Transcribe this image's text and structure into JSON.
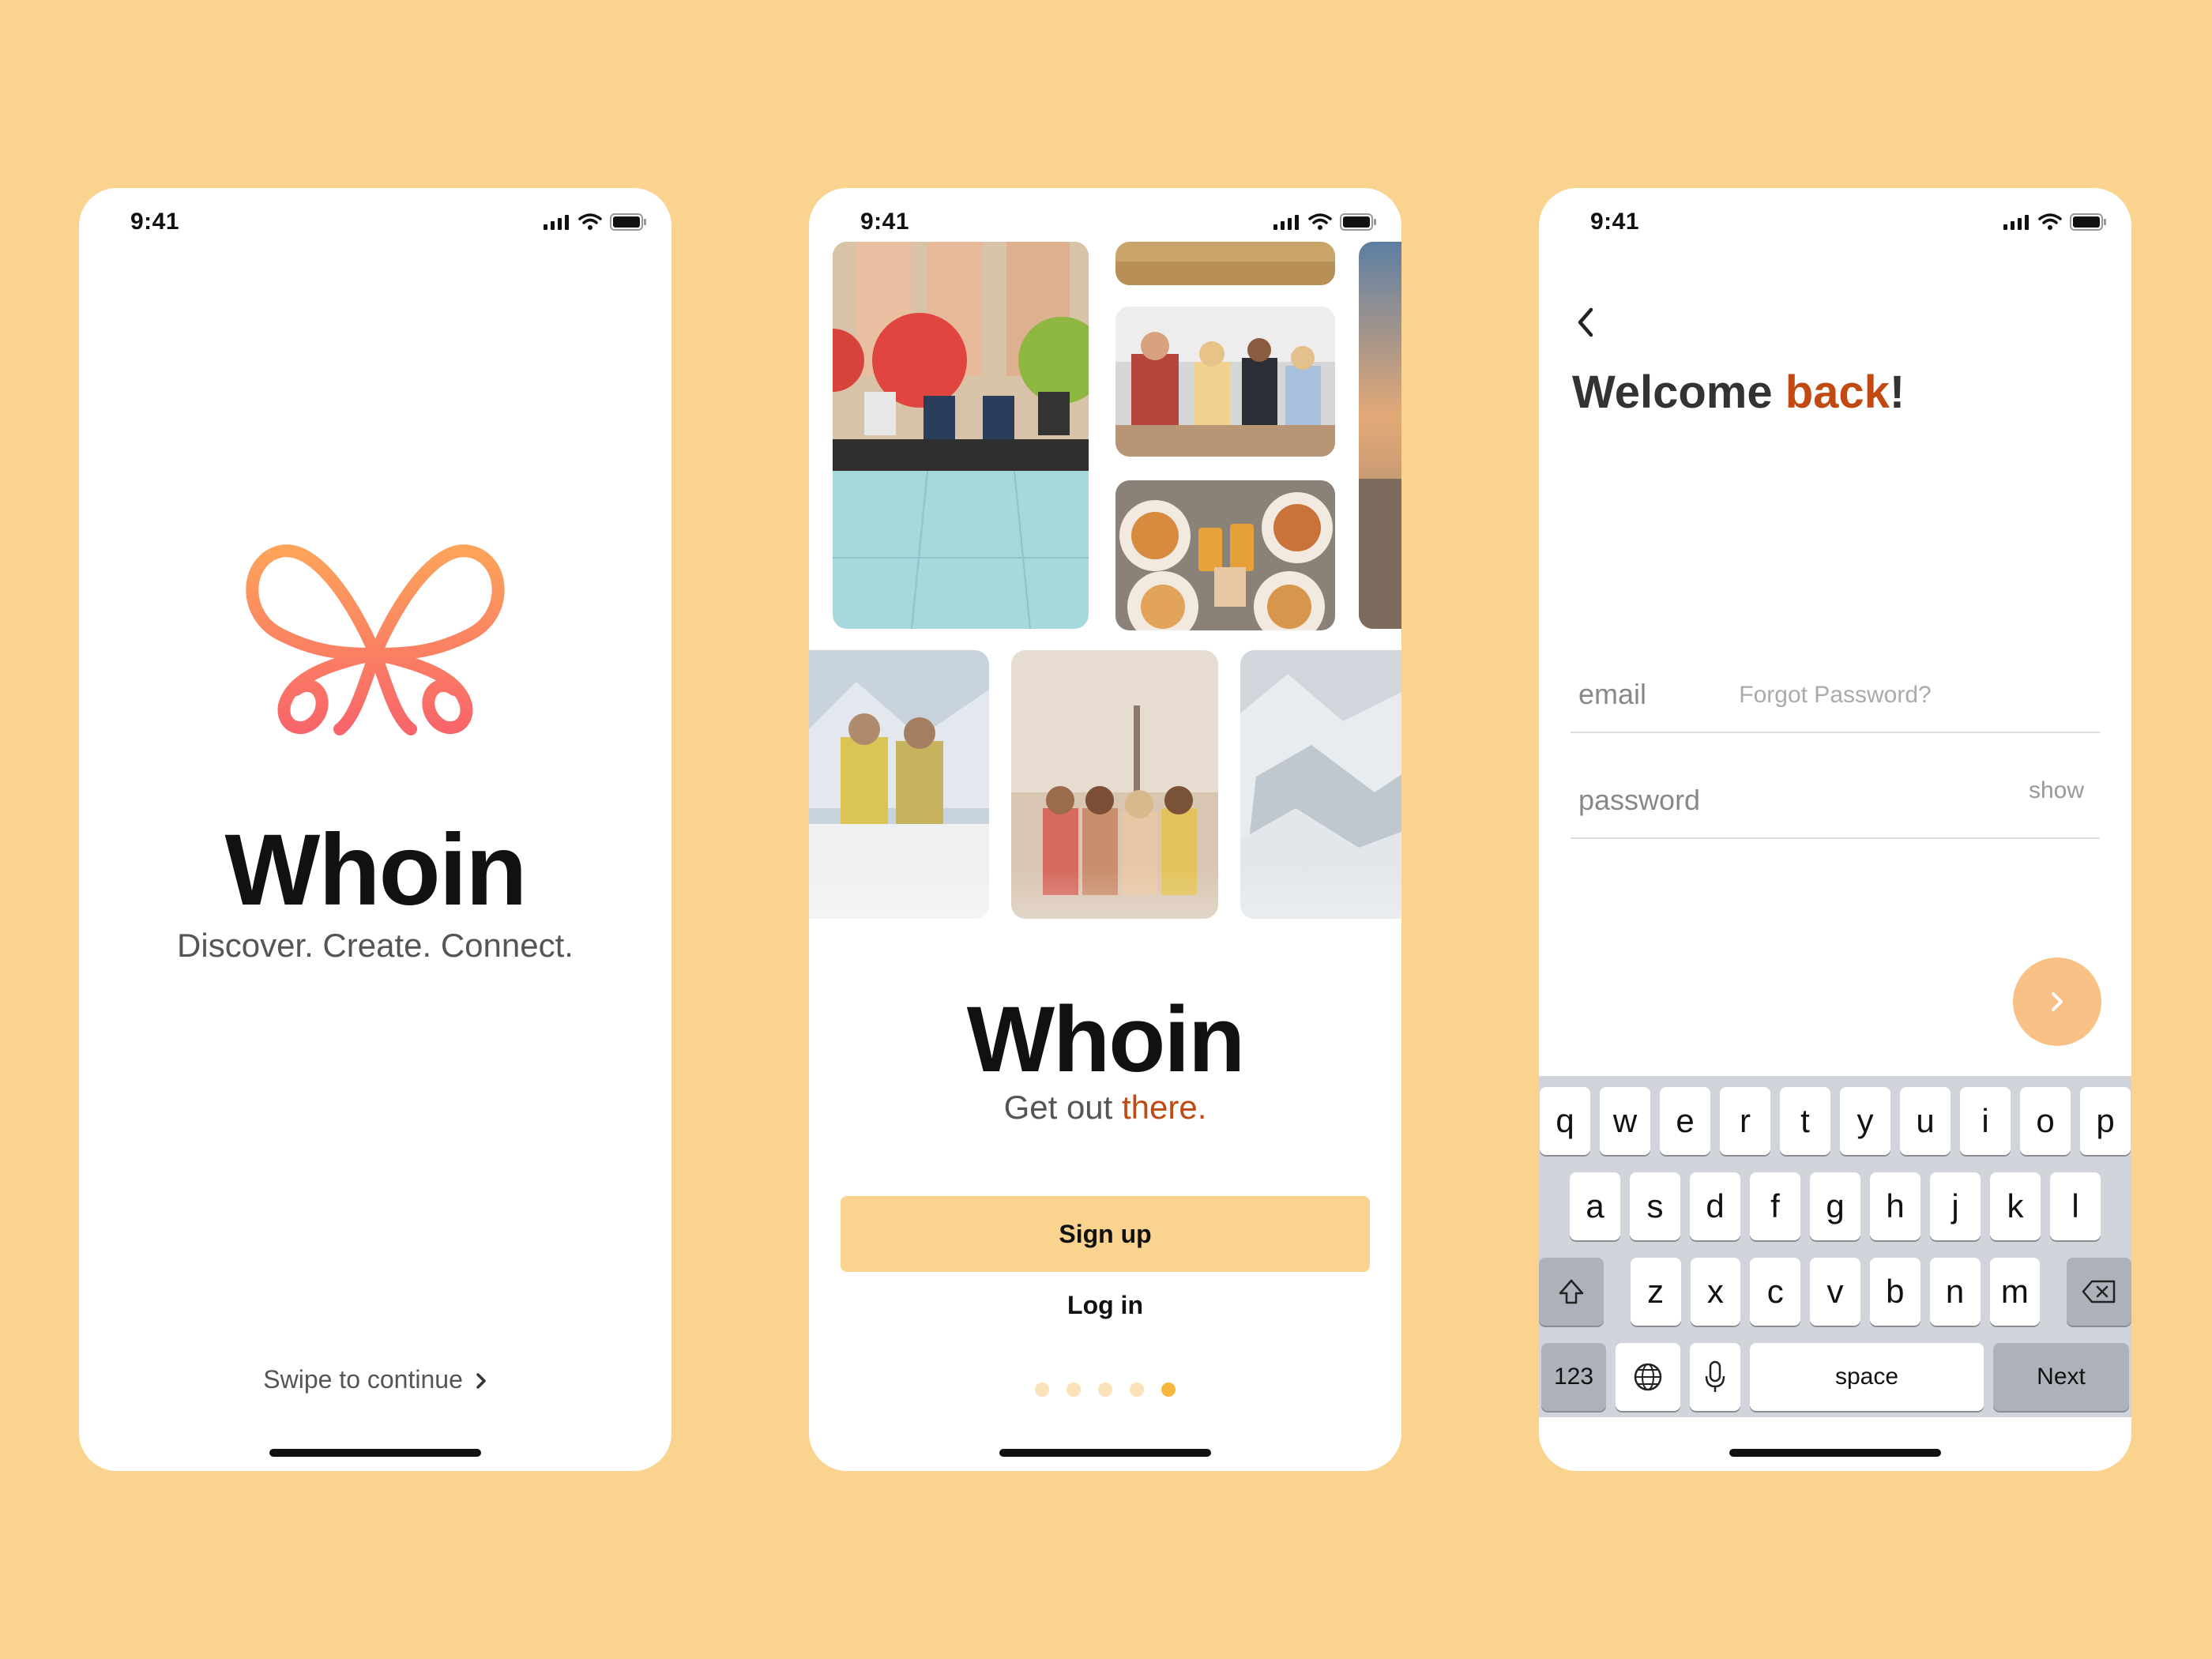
{
  "status": {
    "time": "9:41"
  },
  "screen1": {
    "brand": "Whoin",
    "tagline": "Discover. Create. Connect.",
    "swipe": "Swipe to continue"
  },
  "screen2": {
    "brand": "Whoin",
    "tagline_part1": "Get out ",
    "tagline_accent": "there.",
    "signup_label": "Sign up",
    "login_label": "Log in",
    "page_index": 5,
    "page_count": 5
  },
  "screen3": {
    "title_part1": "Welcome ",
    "title_accent": "back",
    "title_end": "!",
    "email_placeholder": "email",
    "password_placeholder": "password",
    "show_label": "show",
    "forgot_label": "Forgot Password?",
    "keyboard": {
      "row1": [
        "q",
        "w",
        "e",
        "r",
        "t",
        "y",
        "u",
        "i",
        "o",
        "p"
      ],
      "row2": [
        "a",
        "s",
        "d",
        "f",
        "g",
        "h",
        "j",
        "k",
        "l"
      ],
      "row3": [
        "z",
        "x",
        "c",
        "v",
        "b",
        "n",
        "m"
      ],
      "numbers_label": "123",
      "space_label": "space",
      "next_label": "Next"
    }
  },
  "colors": {
    "background": "#FAD38F",
    "accent": "#C14A12",
    "button": "#FAD38F",
    "active_dot": "#F7B73B",
    "next_circle": "#FAC186"
  }
}
